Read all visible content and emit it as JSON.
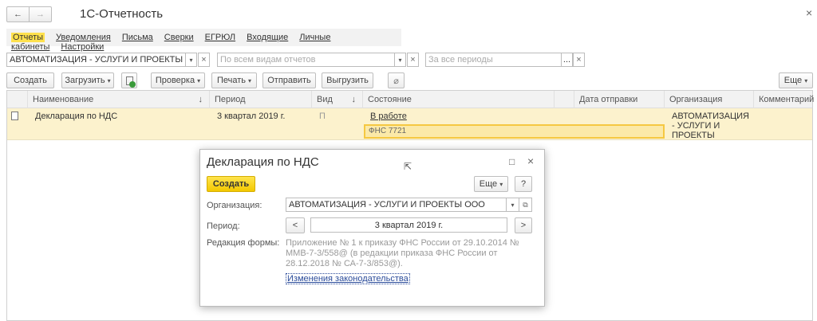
{
  "window": {
    "title": "1С-Отчетность",
    "close": "×",
    "back": "←",
    "forward": "→"
  },
  "menu": [
    "Отчеты",
    "Уведомления",
    "Письма",
    "Сверки",
    "ЕГРЮЛ",
    "Входящие",
    "Личные кабинеты",
    "Настройки"
  ],
  "filters": {
    "organization": "АВТОМАТИЗАЦИЯ - УСЛУГИ И ПРОЕКТЫ ООО",
    "report_type_placeholder": "По всем видам отчетов",
    "period_placeholder": "За все периоды",
    "dropdown": "▾",
    "clear": "×",
    "ellipsis": "..."
  },
  "toolbar": {
    "create": "Создать",
    "load": "Загрузить",
    "check": "Проверка",
    "print": "Печать",
    "send": "Отправить",
    "export": "Выгрузить",
    "more": "Еще"
  },
  "table": {
    "headers": [
      "Наименование",
      "Период",
      "Вид",
      "Состояние",
      "",
      "Дата отправки",
      "Организация",
      "Комментарий"
    ],
    "sort_arrow": "↓",
    "rows": [
      {
        "name": "Декларация по НДС",
        "period": "3 квартал 2019 г.",
        "kind": "П",
        "status": "В работе",
        "authority": "ФНС 7721",
        "date": "",
        "org": "АВТОМАТИЗАЦИЯ - УСЛУГИ И ПРОЕКТЫ",
        "comment": ""
      }
    ]
  },
  "dialog": {
    "title": "Декларация по НДС",
    "create": "Создать",
    "more": "Еще",
    "help": "?",
    "org_label": "Организация:",
    "org_value": "АВТОМАТИЗАЦИЯ - УСЛУГИ И ПРОЕКТЫ ООО",
    "period_label": "Период:",
    "period_value": "3 квартал 2019 г.",
    "prev": "<",
    "next": ">",
    "edition_label": "Редакция формы:",
    "edition_text": "Приложение № 1 к приказу ФНС России от 29.10.2014 № ММВ-7-3/558@ (в редакции приказа ФНС России от 28.12.2018 № СА-7-3/853@).",
    "law_link": "Изменения законодательства",
    "maximize": "□",
    "close": "×"
  }
}
